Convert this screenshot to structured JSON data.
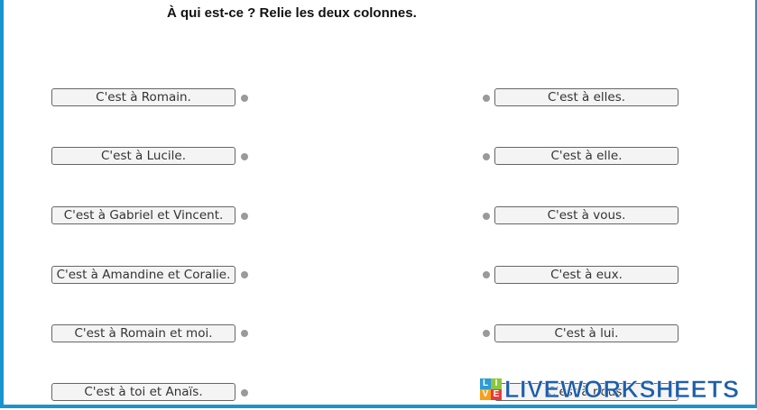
{
  "title": "À qui est-ce ? Relie les deux colonnes.",
  "left_items": [
    "C'est à Romain.",
    "C'est à Lucile.",
    "C'est à Gabriel et Vincent.",
    "C'est à Amandine et Coralie.",
    "C'est à Romain et moi.",
    "C'est à toi et Anaïs."
  ],
  "right_items": [
    "C'est à elles.",
    "C'est à elle.",
    "C'est à vous.",
    "C'est à eux.",
    "C'est à lui.",
    "C'est à nous."
  ],
  "logo": {
    "text": "LIVEWORKSHEETS",
    "letters": [
      "L",
      "I",
      "V",
      "E"
    ],
    "colors": [
      "#2e9bd6",
      "#8cc63f",
      "#f4a21d",
      "#e63d3d"
    ]
  },
  "colors": {
    "frame": "#1a93d1",
    "dot": "#9a9a9a",
    "logo_text": "#1e5faa"
  }
}
